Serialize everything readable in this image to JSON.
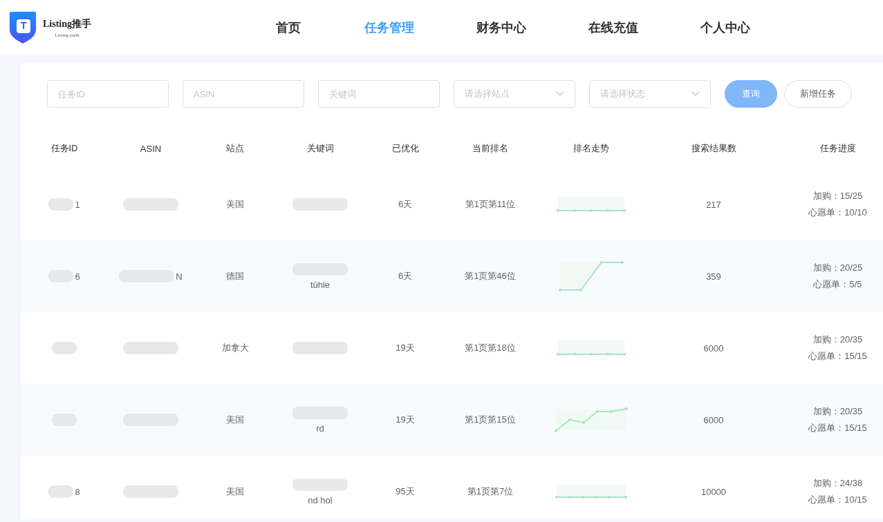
{
  "logo": {
    "title": "Listing推手",
    "subtitle": "Listing push",
    "mark": "T"
  },
  "nav": [
    {
      "label": "首页",
      "selected": false
    },
    {
      "label": "任务管理",
      "selected": true
    },
    {
      "label": "财务中心",
      "selected": false
    },
    {
      "label": "在线充值",
      "selected": false
    },
    {
      "label": "个人中心",
      "selected": false
    }
  ],
  "filters": [
    {
      "kind": "input",
      "placeholder": "任务ID"
    },
    {
      "kind": "input",
      "placeholder": "ASIN"
    },
    {
      "kind": "input",
      "placeholder": "关键词"
    },
    {
      "kind": "select",
      "placeholder": "请选择站点"
    },
    {
      "kind": "select",
      "placeholder": "请选择状态"
    }
  ],
  "buttons": [
    {
      "label": "查询",
      "kind": "primary"
    },
    {
      "label": "新增任务",
      "kind": "plain"
    }
  ],
  "table": {
    "columns": [
      "任务ID",
      "ASIN",
      "站点",
      "关键词",
      "已优化",
      "当前排名",
      "排名走势",
      "搜索结果数",
      "任务进度"
    ],
    "rows": [
      {
        "id": "1",
        "site": "美国",
        "days": "6天",
        "rank": "第1页第11位",
        "trend": {
          "kind": "flat5"
        },
        "results": "217",
        "cart": "加购：15/25",
        "wish": "心愿单：10/10"
      },
      {
        "id": "6",
        "asin": "N",
        "site": "德国",
        "keyword": "tühle",
        "days": "6天",
        "rank": "第1页第46位",
        "trend": {
          "kind": "step"
        },
        "results": "359",
        "cart": "加购：20/25",
        "wish": "心愿单：5/5"
      },
      {
        "site": "加拿大",
        "days": "19天",
        "rank": "第1页第18位",
        "trend": {
          "kind": "flat5"
        },
        "results": "6000",
        "cart": "加购：20/35",
        "wish": "心愿单：15/15"
      },
      {
        "site": "美国",
        "keyword": "rd",
        "days": "19天",
        "rank": "第1页第15位",
        "trend": {
          "kind": "climb"
        },
        "results": "6000",
        "cart": "加购：20/35",
        "wish": "心愿单：15/15"
      },
      {
        "id": "8",
        "site": "美国",
        "keyword": "nd hol",
        "days": "95天",
        "rank": "第1页第7位",
        "trend": {
          "kind": "flat6"
        },
        "results": "10000",
        "cart": "加购：24/38",
        "wish": "心愿单：10/15"
      }
    ]
  }
}
